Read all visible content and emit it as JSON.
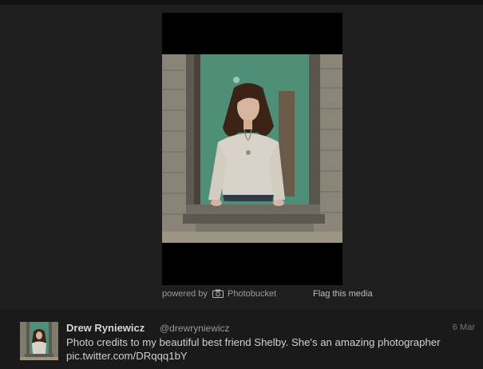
{
  "media": {
    "powered_by_label": "powered by",
    "provider_name": "Photobucket",
    "provider_icon": "camera-icon",
    "flag_label": "Flag this media"
  },
  "tweet": {
    "display_name": "Drew Ryniewicz",
    "handle": "@drewryniewicz",
    "timestamp": "6 Mar",
    "text": "Photo credits to my beautiful best friend Shelby. She's an amazing photographer",
    "link": "pic.twitter.com/DRqqq1bY"
  },
  "colors": {
    "background": "#1e1e1e",
    "media_background": "#000000",
    "tweet_background": "#1a1a1a",
    "text": "#d0d0d0",
    "muted": "#9a9a9a"
  }
}
